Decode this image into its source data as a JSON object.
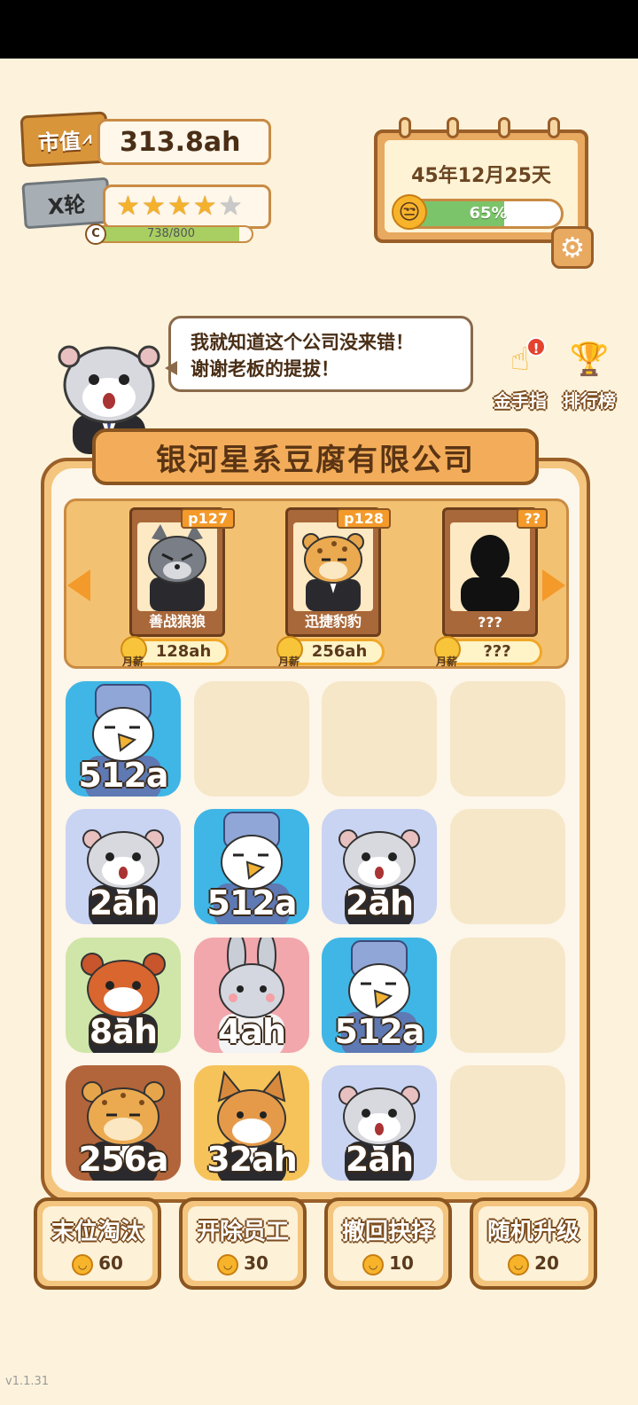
{
  "stats": {
    "market_label": "市值",
    "market_value": "313.8ah",
    "round_label": "X轮",
    "stars_on": 4,
    "stars_total": 5,
    "xp_letter": "C",
    "xp_current": 738,
    "xp_max": 800,
    "xp_text": "738/800"
  },
  "calendar": {
    "date": "45年12月25天",
    "mood_text": "65%",
    "mood_value": 0.65
  },
  "speech": {
    "line1": "我就知道这个公司没来错！",
    "line2": "谢谢老板的提拔！"
  },
  "side_buttons": {
    "golden_finger": "金手指",
    "leaderboard": "排行榜",
    "alert": "!"
  },
  "company_name": "银河星系豆腐有限公司",
  "recruits": [
    {
      "tag": "p127",
      "name": "善战狼狼",
      "salary": "128ah",
      "salary_label": "月薪"
    },
    {
      "tag": "p128",
      "name": "迅捷豹豹",
      "salary": "256ah",
      "salary_label": "月薪"
    },
    {
      "tag": "??",
      "name": "???",
      "salary": "???",
      "salary_label": "月薪"
    }
  ],
  "grid": [
    [
      {
        "animal": "eagle",
        "value": "512a"
      },
      {
        "animal": "",
        "value": ""
      },
      {
        "animal": "",
        "value": ""
      },
      {
        "animal": "",
        "value": ""
      }
    ],
    [
      {
        "animal": "hamster",
        "value": "2ah"
      },
      {
        "animal": "eagle",
        "value": "512a"
      },
      {
        "animal": "hamster",
        "value": "2ah"
      },
      {
        "animal": "",
        "value": ""
      }
    ],
    [
      {
        "animal": "red-panda",
        "value": "8ah"
      },
      {
        "animal": "rabbit",
        "value": "4ah"
      },
      {
        "animal": "eagle",
        "value": "512a"
      },
      {
        "animal": "",
        "value": ""
      }
    ],
    [
      {
        "animal": "leopard",
        "value": "256a"
      },
      {
        "animal": "shiba",
        "value": "32ah"
      },
      {
        "animal": "hamster",
        "value": "2ah"
      },
      {
        "animal": "",
        "value": ""
      }
    ]
  ],
  "actions": [
    {
      "label": "末位淘汰",
      "cost": "60"
    },
    {
      "label": "开除员工",
      "cost": "30"
    },
    {
      "label": "撤回抉择",
      "cost": "10"
    },
    {
      "label": "随机升级",
      "cost": "20"
    }
  ],
  "version": "v1.1.31",
  "colors": {
    "eagle_bg": "#3fb6e6",
    "hamster_bg": "#c9d3f2",
    "red_panda_bg": "#cfe6a8",
    "rabbit_bg": "#f2a7ad",
    "leopard_bg": "#b2643a",
    "shiba_bg": "#f6c35a"
  }
}
